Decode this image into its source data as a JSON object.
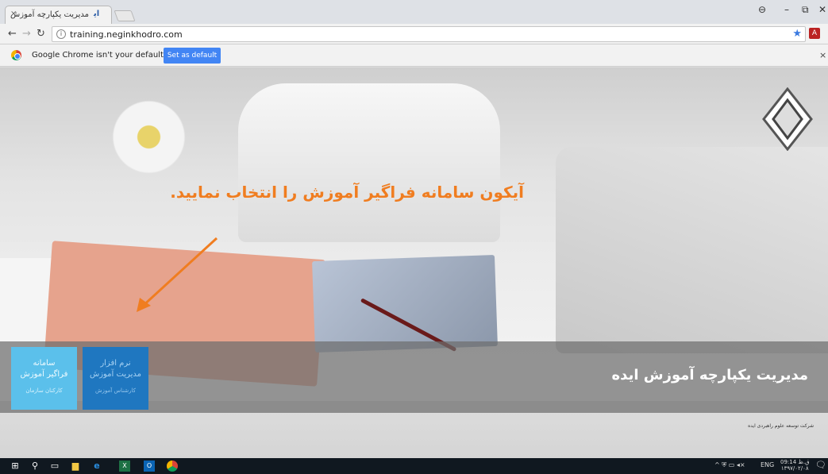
{
  "browser": {
    "tab_title": "مدیریت یکپارچه آموزش",
    "tab_close": "×",
    "url": "training.neginkhodro.com",
    "infobar_message": "Google Chrome isn't your default browser",
    "infobar_button": "Set as default",
    "infobar_close": "×",
    "window_controls": {
      "minimize": "–",
      "restore": "⧉",
      "close": "✕"
    }
  },
  "page": {
    "instruction": "آیکون سامانه فراگیر آموزش را انتخاب نمایید.",
    "tiles": [
      {
        "line1": "سامانه",
        "line2": "فراگیر آموزش",
        "sub": "کارکنان سازمان"
      },
      {
        "line1": "نرم افزار",
        "line2": "مدیریت آموزش",
        "sub": "کارشناس آموزش"
      }
    ],
    "portal_title": "مدیریت یکپارچه آموزش ایده",
    "footer_note": "شرکت توسعه علوم راهبردی ایده"
  },
  "taskbar": {
    "language": "ENG",
    "time": "09:14 ق.ظ",
    "date": "۱۳۹۷/۰۲/۰۸"
  },
  "colors": {
    "instruction": "#f07d20",
    "tile1": "#5bc0eb",
    "tile2": "#1f77c0",
    "set_default_button": "#4285f4"
  }
}
